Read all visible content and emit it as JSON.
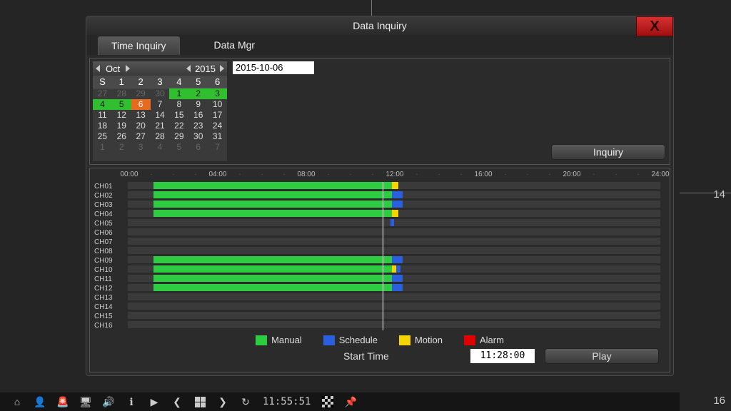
{
  "backdrop": {
    "right_num": "14",
    "bottom_num": "16"
  },
  "window": {
    "title": "Data Inquiry",
    "tabs": [
      {
        "label": "Time Inquiry",
        "active": true
      },
      {
        "label": "Data Mgr",
        "active": false
      }
    ],
    "calendar": {
      "month": "Oct",
      "year": "2015",
      "day_headers": [
        "S",
        "1",
        "2",
        "3",
        "4",
        "5",
        "6"
      ],
      "weeks": [
        [
          {
            "n": "27",
            "c": "dim"
          },
          {
            "n": "28",
            "c": "dim"
          },
          {
            "n": "29",
            "c": "dim"
          },
          {
            "n": "30",
            "c": "dim"
          },
          {
            "n": "1",
            "c": "green"
          },
          {
            "n": "2",
            "c": "green"
          },
          {
            "n": "3",
            "c": "green"
          }
        ],
        [
          {
            "n": "4",
            "c": "green"
          },
          {
            "n": "5",
            "c": "green"
          },
          {
            "n": "6",
            "c": "sel"
          },
          {
            "n": "7",
            "c": ""
          },
          {
            "n": "8",
            "c": ""
          },
          {
            "n": "9",
            "c": ""
          },
          {
            "n": "10",
            "c": ""
          }
        ],
        [
          {
            "n": "11",
            "c": ""
          },
          {
            "n": "12",
            "c": ""
          },
          {
            "n": "13",
            "c": ""
          },
          {
            "n": "14",
            "c": ""
          },
          {
            "n": "15",
            "c": ""
          },
          {
            "n": "16",
            "c": ""
          },
          {
            "n": "17",
            "c": ""
          }
        ],
        [
          {
            "n": "18",
            "c": ""
          },
          {
            "n": "19",
            "c": ""
          },
          {
            "n": "20",
            "c": ""
          },
          {
            "n": "21",
            "c": ""
          },
          {
            "n": "22",
            "c": ""
          },
          {
            "n": "23",
            "c": ""
          },
          {
            "n": "24",
            "c": ""
          }
        ],
        [
          {
            "n": "25",
            "c": ""
          },
          {
            "n": "26",
            "c": ""
          },
          {
            "n": "27",
            "c": ""
          },
          {
            "n": "28",
            "c": ""
          },
          {
            "n": "29",
            "c": ""
          },
          {
            "n": "30",
            "c": ""
          },
          {
            "n": "31",
            "c": ""
          }
        ],
        [
          {
            "n": "1",
            "c": "dim"
          },
          {
            "n": "2",
            "c": "dim"
          },
          {
            "n": "3",
            "c": "dim"
          },
          {
            "n": "4",
            "c": "dim"
          },
          {
            "n": "5",
            "c": "dim"
          },
          {
            "n": "6",
            "c": "dim"
          },
          {
            "n": "7",
            "c": "dim"
          }
        ]
      ]
    },
    "date_value": "2015-10-06",
    "inquiry_label": "Inquiry",
    "time_ticks": [
      "00:00",
      "04:00",
      "08:00",
      "12:00",
      "16:00",
      "20:00",
      "24:00"
    ],
    "channels": [
      "CH01",
      "CH02",
      "CH03",
      "CH04",
      "CH05",
      "CH06",
      "CH07",
      "CH08",
      "CH09",
      "CH10",
      "CH11",
      "CH12",
      "CH13",
      "CH14",
      "CH15",
      "CH16"
    ],
    "legend": {
      "manual": "Manual",
      "schedule": "Schedule",
      "motion": "Motion",
      "alarm": "Alarm"
    },
    "start_time_label": "Start Time",
    "start_time_value": "11:28:00",
    "play_label": "Play"
  },
  "taskbar": {
    "clock": "11:55:51"
  },
  "chart_data": {
    "type": "timeline",
    "x_range_hours": [
      0,
      24
    ],
    "playhead_hour": 11.47,
    "series": [
      {
        "channel": "CH01",
        "segments": [
          {
            "type": "manual",
            "start": 1.15,
            "end": 11.9
          },
          {
            "type": "motion",
            "start": 11.9,
            "end": 12.2
          }
        ]
      },
      {
        "channel": "CH02",
        "segments": [
          {
            "type": "manual",
            "start": 1.15,
            "end": 11.9
          },
          {
            "type": "schedule",
            "start": 11.9,
            "end": 12.4
          }
        ]
      },
      {
        "channel": "CH03",
        "segments": [
          {
            "type": "manual",
            "start": 1.15,
            "end": 11.9
          },
          {
            "type": "schedule",
            "start": 11.9,
            "end": 12.4
          }
        ]
      },
      {
        "channel": "CH04",
        "segments": [
          {
            "type": "manual",
            "start": 1.15,
            "end": 11.9
          },
          {
            "type": "motion",
            "start": 11.9,
            "end": 12.2
          }
        ]
      },
      {
        "channel": "CH05",
        "segments": [
          {
            "type": "schedule",
            "start": 11.85,
            "end": 12.0
          }
        ]
      },
      {
        "channel": "CH06",
        "segments": []
      },
      {
        "channel": "CH07",
        "segments": []
      },
      {
        "channel": "CH08",
        "segments": []
      },
      {
        "channel": "CH09",
        "segments": [
          {
            "type": "manual",
            "start": 1.15,
            "end": 11.9
          },
          {
            "type": "schedule",
            "start": 11.9,
            "end": 12.4
          }
        ]
      },
      {
        "channel": "CH10",
        "segments": [
          {
            "type": "manual",
            "start": 1.15,
            "end": 11.9
          },
          {
            "type": "motion",
            "start": 11.9,
            "end": 12.1
          },
          {
            "type": "schedule",
            "start": 12.1,
            "end": 12.3
          }
        ]
      },
      {
        "channel": "CH11",
        "segments": [
          {
            "type": "manual",
            "start": 1.15,
            "end": 11.9
          },
          {
            "type": "schedule",
            "start": 11.9,
            "end": 12.4
          }
        ]
      },
      {
        "channel": "CH12",
        "segments": [
          {
            "type": "manual",
            "start": 1.15,
            "end": 11.9
          },
          {
            "type": "schedule",
            "start": 11.9,
            "end": 12.4
          }
        ]
      },
      {
        "channel": "CH13",
        "segments": []
      },
      {
        "channel": "CH14",
        "segments": []
      },
      {
        "channel": "CH15",
        "segments": []
      },
      {
        "channel": "CH16",
        "segments": []
      }
    ]
  }
}
